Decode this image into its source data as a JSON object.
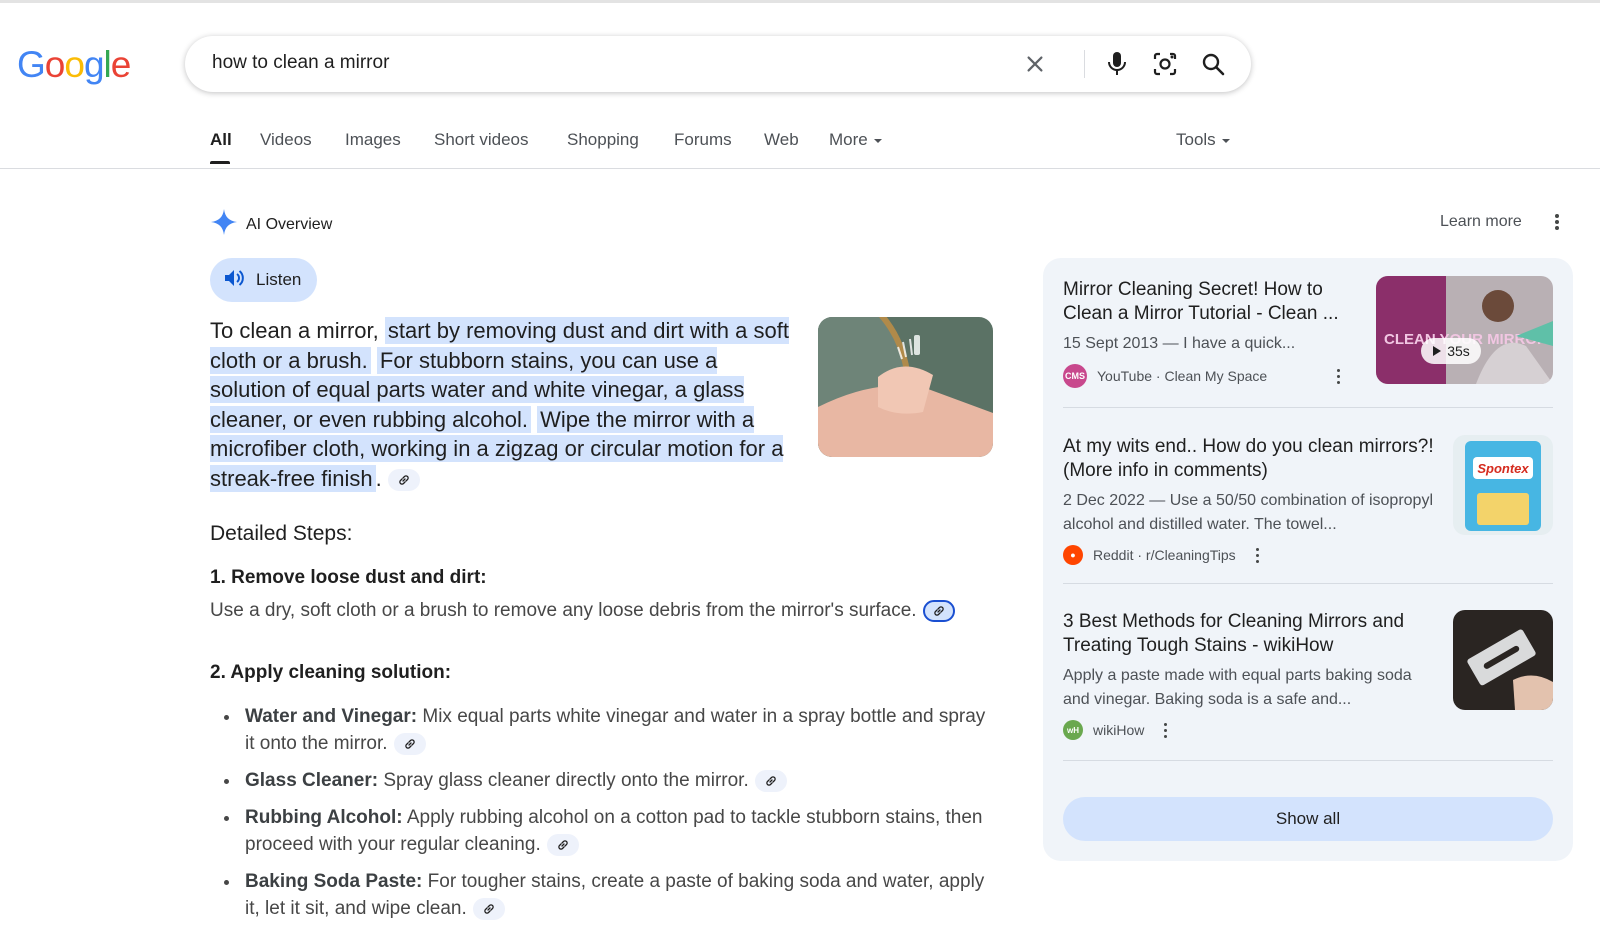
{
  "header": {
    "logo": [
      "G",
      "o",
      "o",
      "g",
      "l",
      "e"
    ],
    "logo_colors": [
      "#4285F4",
      "#EA4335",
      "#FBBC05",
      "#4285F4",
      "#34A853",
      "#EA4335"
    ],
    "search_value": "how to clean a mirror"
  },
  "tabs": [
    {
      "label": "All",
      "active": true
    },
    {
      "label": "Videos"
    },
    {
      "label": "Images"
    },
    {
      "label": "Short videos"
    },
    {
      "label": "Shopping"
    },
    {
      "label": "Forums"
    },
    {
      "label": "Web"
    },
    {
      "label": "More"
    },
    {
      "label": "Tools"
    }
  ],
  "ai_overview": {
    "title": "AI Overview",
    "learn_more": "Learn more",
    "listen": "Listen",
    "intro": "To clean a mirror,",
    "highlights": [
      "start by removing dust and dirt with a soft cloth or a brush.",
      "For stubborn stains, you can use a solution of equal parts water and white vinegar, a glass cleaner, or even rubbing alcohol.",
      "Wipe the mirror with a microfiber cloth, working in a zigzag or circular motion for a streak-free finish"
    ],
    "period": ".",
    "steps_title": "Detailed Steps:",
    "step1_head": "1. Remove loose dust and dirt:",
    "step1_body": "Use a dry, soft cloth or a brush to remove any loose debris from the mirror's surface.",
    "step2_head": "2. Apply cleaning solution:",
    "bullets": [
      {
        "bold": "Water and Vinegar:",
        "text": " Mix equal parts white vinegar and water in a spray bottle and spray it onto the mirror."
      },
      {
        "bold": "Glass Cleaner:",
        "text": " Spray glass cleaner directly onto the mirror."
      },
      {
        "bold": "Rubbing Alcohol:",
        "text": " Apply rubbing alcohol on a cotton pad to tackle stubborn stains, then proceed with your regular cleaning."
      },
      {
        "bold": "Baking Soda Paste:",
        "text": " For tougher stains, create a paste of baking soda and water, apply it, let it sit, and wipe clean."
      }
    ]
  },
  "sources": [
    {
      "title": "Mirror Cleaning Secret! How to Clean a Mirror Tutorial - Clean ...",
      "snippet": "15 Sept 2013 — I have a quick...",
      "site": "YouTube · Clean My Space",
      "duration": "35s",
      "thumb_text": "CLEAN YOUR MIRROR"
    },
    {
      "title": "At my wits end.. How do you clean mirrors?! (More info in comments)",
      "snippet": "2 Dec 2022 — Use a 50/50 combination of isopropyl alcohol and distilled water. The towel...",
      "site": "Reddit · r/CleaningTips",
      "thumb_text": "Spontex"
    },
    {
      "title": "3 Best Methods for Cleaning Mirrors and Treating Tough Stains - wikiHow",
      "snippet": "Apply a paste made with equal parts baking soda and vinegar. Baking soda is a safe and...",
      "site": "wikiHow"
    }
  ],
  "show_all": "Show all",
  "colors": {
    "accent": "#d3e3fd",
    "panel": "#f0f4f9",
    "ai_star": "#4285F4"
  }
}
